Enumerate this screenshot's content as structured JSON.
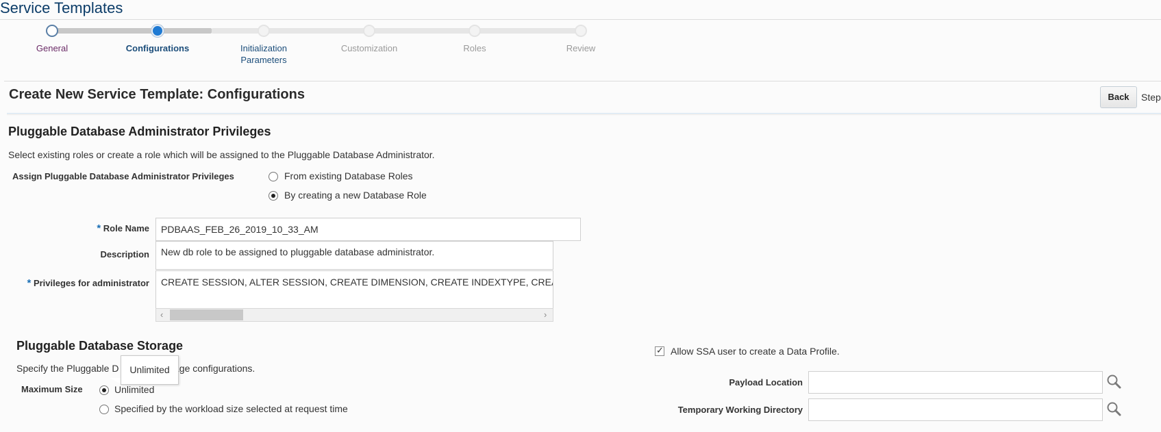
{
  "app": {
    "title": "Service Templates"
  },
  "train": {
    "steps": [
      {
        "label": "General",
        "state": "visited"
      },
      {
        "label": "Configurations",
        "state": "current"
      },
      {
        "label": "Initialization Parameters",
        "line1": "Initialization",
        "line2": "Parameters",
        "state": "next"
      },
      {
        "label": "Customization",
        "state": "future"
      },
      {
        "label": "Roles",
        "state": "future"
      },
      {
        "label": "Review",
        "state": "future"
      }
    ]
  },
  "page": {
    "title": "Create New Service Template: Configurations",
    "back_label": "Back",
    "step_text": "Step"
  },
  "privileges": {
    "heading": "Pluggable Database Administrator Privileges",
    "description": "Select existing roles or create a role which will be assigned to the Pluggable Database Administrator.",
    "assign_label": "Assign Pluggable Database Administrator Privileges",
    "option_existing": "From existing Database Roles",
    "option_new": "By creating a new Database Role",
    "selected": "new",
    "role_name_label": "Role Name",
    "role_name_value": "PDBAAS_FEB_26_2019_10_33_AM",
    "description_label": "Description",
    "description_value": "New db role to be assigned to pluggable database administrator.",
    "privileges_label": "Privileges for administrator",
    "privileges_value": "CREATE SESSION, ALTER SESSION, CREATE DIMENSION, CREATE INDEXTYPE, CREATE",
    "required_marker": "*"
  },
  "storage": {
    "heading": "Pluggable Database Storage",
    "description_before": "Specify the Pluggable D",
    "description_after": "age configurations.",
    "max_size_label": "Maximum Size",
    "option_unlimited": "Unlimited",
    "option_workload": "Specified by the workload size selected at request time",
    "selected": "unlimited",
    "tooltip": "Unlimited"
  },
  "data_profile": {
    "allow_label": "Allow SSA user to create a Data Profile.",
    "allow_checked": true,
    "check_glyph": "✓",
    "payload_label": "Payload Location",
    "payload_value": "",
    "temp_dir_label": "Temporary Working Directory",
    "temp_dir_value": ""
  },
  "icons": {
    "search": "search-icon",
    "scroll_left": "chevron-left-icon",
    "scroll_right": "chevron-right-icon",
    "arrow_left_glyph": "‹",
    "arrow_right_glyph": "›"
  },
  "colors": {
    "title_blue": "#0b3c68",
    "current_stop": "#1f7ad3",
    "required_star": "#1b6fb5"
  }
}
